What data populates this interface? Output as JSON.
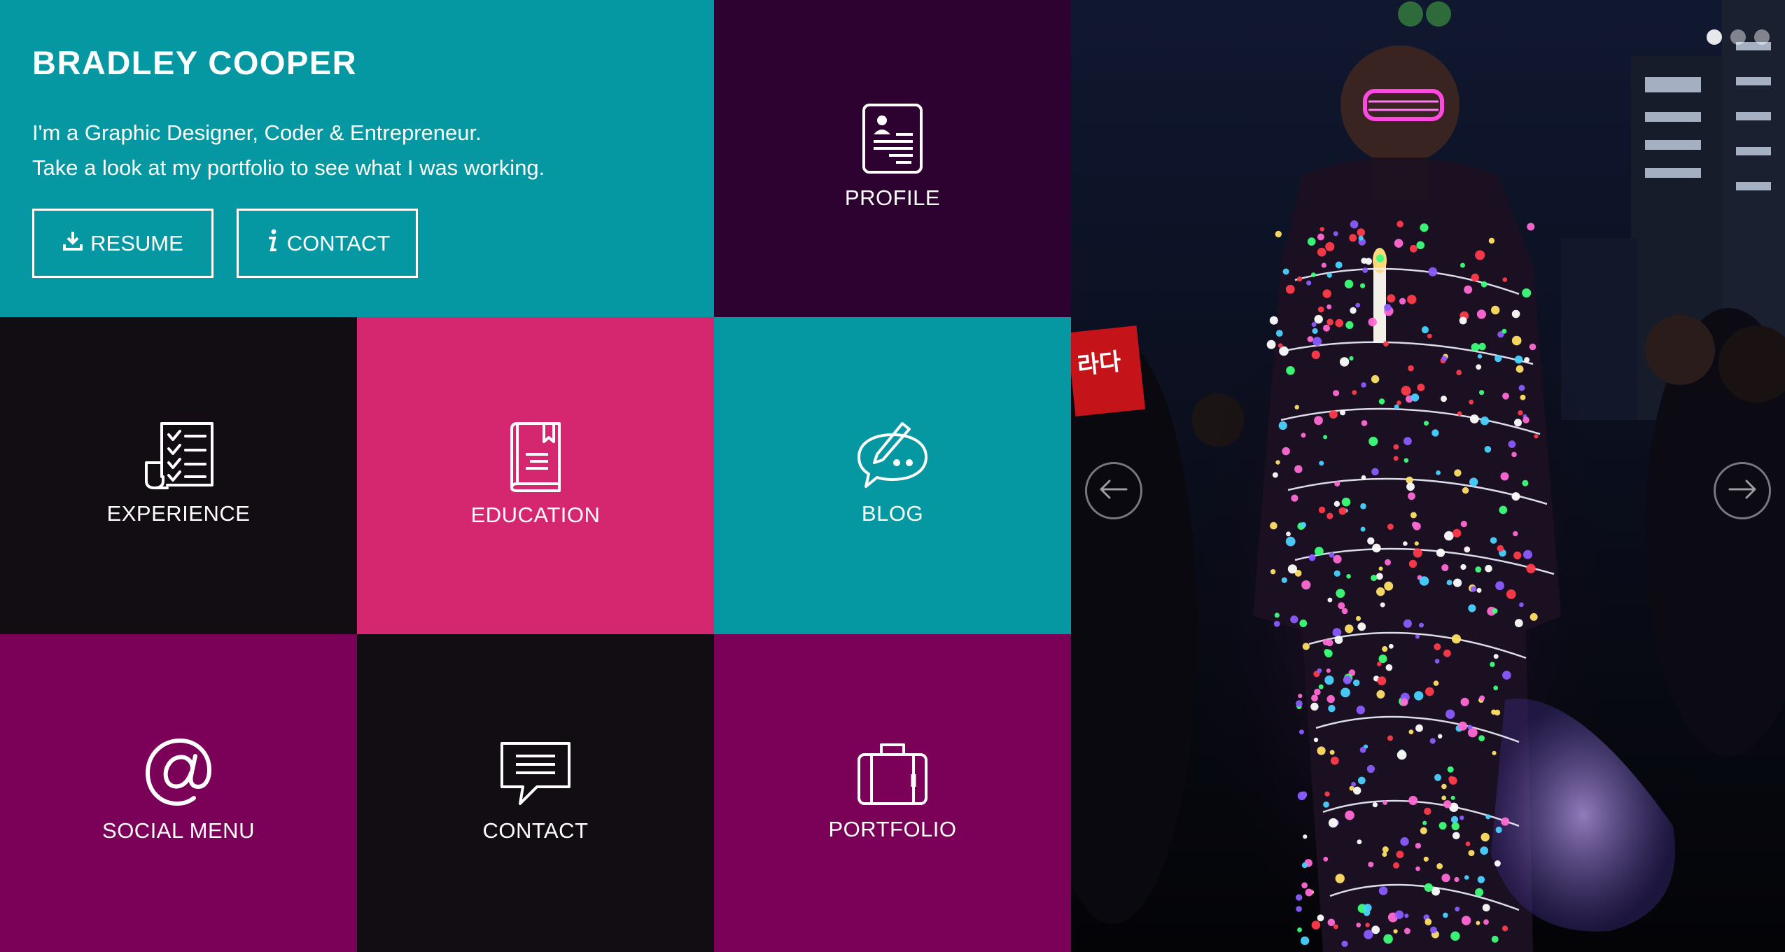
{
  "intro": {
    "name": "BRADLEY COOPER",
    "line1": "I'm a Graphic Designer, Coder & Entrepreneur.",
    "line2": "Take a look at my portfolio to see what I was working.",
    "resume_label": "RESUME",
    "contact_label": "CONTACT"
  },
  "tiles": {
    "profile": "PROFILE",
    "experience": "EXPERIENCE",
    "education": "EDUCATION",
    "blog": "BLOG",
    "social": "SOCIAL MENU",
    "contact": "CONTACT",
    "portfolio": "PORTFOLIO"
  },
  "slider": {
    "photo_sign_text": "라다\n이다",
    "slide_count": 3,
    "active_slide": 1
  },
  "colors": {
    "teal": "#0698a2",
    "dark_purple": "#2d0130",
    "near_black": "#120d12",
    "pink": "#d52670",
    "magenta": "#7a0058"
  },
  "icons": {
    "resume_button": "download-icon",
    "contact_button": "info-icon",
    "profile": "resume-document-icon",
    "experience": "checklist-icon",
    "education": "book-icon",
    "blog": "chat-pencil-icon",
    "social": "at-sign-icon",
    "contact": "speech-bubble-icon",
    "portfolio": "briefcase-icon",
    "slider_prev": "arrow-left-icon",
    "slider_next": "arrow-right-icon"
  }
}
